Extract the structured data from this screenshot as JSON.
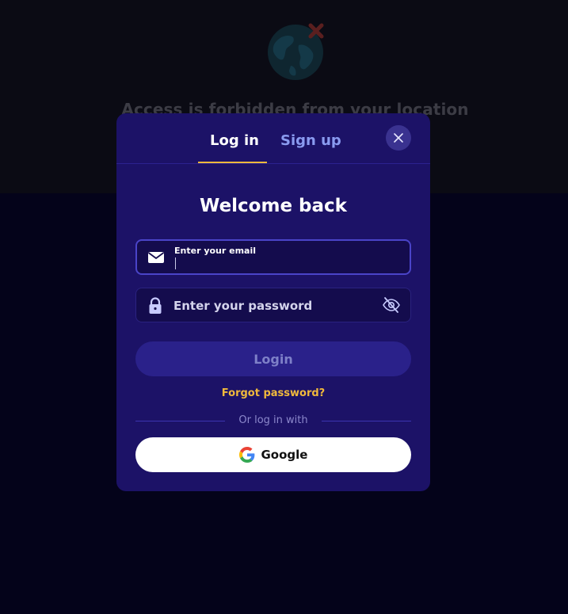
{
  "background": {
    "title": "Access is forbidden from your location",
    "globe_icon": "globe-blocked-icon"
  },
  "modal": {
    "tabs": [
      {
        "label": "Log in",
        "active": true
      },
      {
        "label": "Sign up",
        "active": false
      }
    ],
    "close_icon": "close-icon",
    "heading": "Welcome back",
    "email": {
      "label": "Enter your email",
      "value": "",
      "icon": "envelope-icon"
    },
    "password": {
      "placeholder": "Enter your password",
      "value": "",
      "icon": "lock-icon",
      "toggle_icon": "eye-off-icon"
    },
    "login_label": "Login",
    "forgot_label": "Forgot password?",
    "divider_text": "Or log in with",
    "google_label": "Google"
  },
  "colors": {
    "modal_bg": "#1c1267",
    "accent": "#f0b93c",
    "tab_inactive": "#8a9bf0",
    "page_bg": "#04031a"
  }
}
